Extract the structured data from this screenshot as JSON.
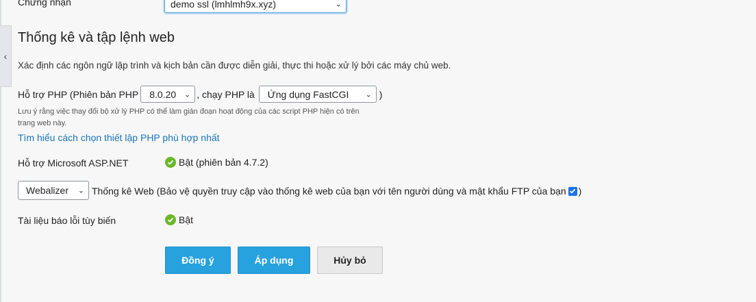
{
  "certificate": {
    "label": "Chứng nhận",
    "selected": "demo ssl (lmhlmh9x.xyz)"
  },
  "section": {
    "title": "Thống kê và tập lệnh web",
    "description": "Xác định các ngôn ngữ lập trình và kịch bản cần được diễn giải, thực thi hoặc xử lý bởi các máy chủ web."
  },
  "php": {
    "prefix": "Hỗ trợ PHP (Phiên bản PHP",
    "version": "8.0.20",
    "run_as_text": ", chạy PHP là",
    "handler": "Ứng dụng FastCGI",
    "suffix": ")",
    "note": "Lưu ý rằng việc thay đổi bộ xử lý PHP có thể làm gián đoạn hoạt động của các script PHP hiện có trên trang web này.",
    "learn_link": "Tìm hiểu cách chọn thiết lập PHP phù hợp nhất"
  },
  "aspnet": {
    "label": "Hỗ trợ Microsoft ASP.NET",
    "status": "Bật (phiên bản 4.7.2)"
  },
  "web_stats": {
    "selected": "Webalizer",
    "text": "Thống kê Web (Bảo vệ quyền truy cập vào thống kê web của bạn với tên người dùng và mật khẩu FTP của bạn",
    "suffix": ")",
    "protect_checked": true
  },
  "error_docs": {
    "label": "Tài liệu báo lỗi tùy biến",
    "status": "Bật"
  },
  "buttons": {
    "ok": "Đồng ý",
    "apply": "Áp dụng",
    "cancel": "Hủy bỏ"
  },
  "icons": {
    "collapse": "chevron-left-icon",
    "status": "check-circle-icon",
    "dropdown": "chevron-down-icon"
  },
  "colors": {
    "primary_button": "#28a2df",
    "link": "#1a75b9",
    "status_green": "#6bb72a",
    "checkbox": "#1a73e8"
  }
}
